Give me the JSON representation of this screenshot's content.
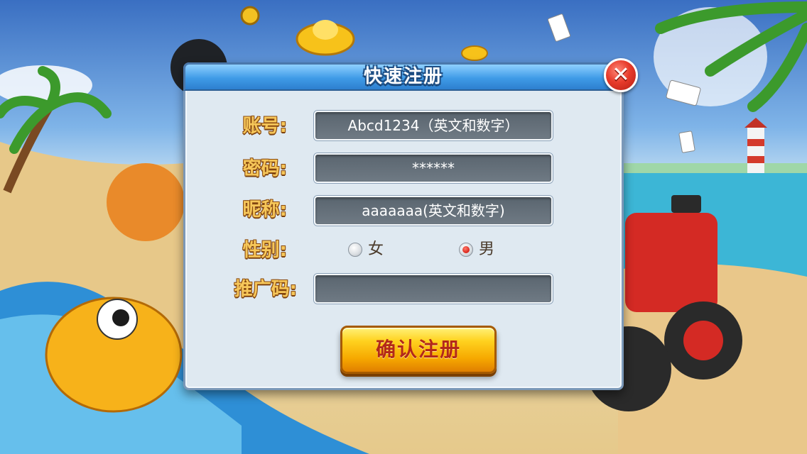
{
  "dialog": {
    "title": "快速注册",
    "close_icon": "close-x-icon"
  },
  "form": {
    "account_label": "账号:",
    "account_placeholder": "Abcd1234（英文和数字）",
    "password_label": "密码:",
    "password_placeholder": "******",
    "nickname_label": "昵称:",
    "nickname_placeholder": "aaaaaaa(英文和数字)",
    "gender_label": "性别:",
    "gender_options": [
      {
        "label": "女",
        "selected": false
      },
      {
        "label": "男",
        "selected": true
      }
    ],
    "referral_label": "推广码:",
    "referral_value": ""
  },
  "actions": {
    "confirm_label": "确认注册"
  },
  "colors": {
    "title_bar": "#3f9be7",
    "label_gold": "#f6c75a",
    "field_bg": "#5a656f",
    "confirm_bg": "#ffd21f",
    "confirm_text": "#b3281a",
    "close_red": "#e73b2b"
  }
}
